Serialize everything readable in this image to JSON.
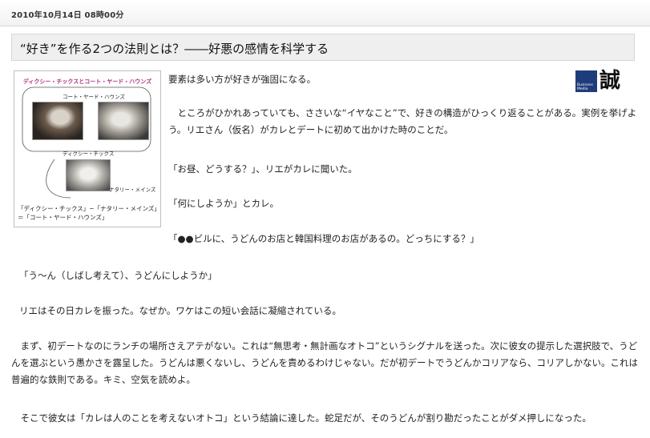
{
  "date": "2010年10月14日 08時00分",
  "title": "“好き”を作る2つの法則とは？――好悪の感情を科学する",
  "figure": {
    "title": "ディクシー・チックスとコート・ヤード・ハウンズ",
    "label_top": "コート・ヤード・ハウンズ",
    "label_mid": "ディクシー・チックス",
    "label_bottom": "ナタリー・メインズ",
    "caption": "「ディクシー・チックス」−「ナタリー・メインズ」＝「コート・ヤード・ハウンズ」"
  },
  "logo": {
    "badge_line1": "Business",
    "badge_line2": "Media",
    "kanji": "誠"
  },
  "paragraphs": [
    "要素は多い方が好きが強固になる。",
    "　ところがひかれあっていても、ささいな“イヤなこと”で、好きの構造がひっくり返ることがある。実例を挙げよう。リエさん（仮名）がカレとデートに初めて出かけた時のことだ。",
    "「お昼、どうする？」、リエがカレに聞いた。",
    "「何にしようか」とカレ。",
    "「●●ビルに、うどんのお店と韓国料理のお店があるの。どっちにする？」",
    "「う〜ん（しばし考えて）、うどんにしようか」",
    "リエはその日カレを振った。なぜか。ワケはこの短い会話に凝縮されている。",
    "　まず、初デートなのにランチの場所さえアテがない。これは“無思考・無計画なオトコ”というシグナルを送った。次に彼女の提示した選択肢で、うどんを選ぶという愚かさを露呈した。うどんは悪くないし、うどんを責めるわけじゃない。だが初デートでうどんかコリアなら、コリアしかない。これは普遍的な鉄則である。キミ、空気を読めよ。",
    "　そこで彼女は「カレは人のことを考えないオトコ」という結論に達した。蛇足だが、そのうどんが割り勘だったことがダメ押しになった。"
  ]
}
